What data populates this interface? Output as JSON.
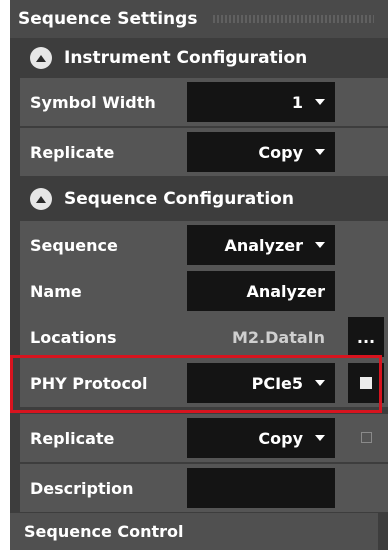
{
  "panel": {
    "title": "Sequence Settings"
  },
  "instrument_config": {
    "header": "Instrument Configuration",
    "rows": {
      "symbol_width": {
        "label": "Symbol Width",
        "value": "1"
      },
      "replicate": {
        "label": "Replicate",
        "value": "Copy"
      }
    }
  },
  "sequence_config": {
    "header": "Sequence Configuration",
    "rows": {
      "sequence": {
        "label": "Sequence",
        "value": "Analyzer"
      },
      "name": {
        "label": "Name",
        "value": "Analyzer"
      },
      "locations": {
        "label": "Locations",
        "value": "M2.DataIn",
        "button": "..."
      },
      "phy_protocol": {
        "label": "PHY Protocol",
        "value": "PCIe5",
        "checked": true
      },
      "replicate": {
        "label": "Replicate",
        "value": "Copy",
        "checked": false
      },
      "description": {
        "label": "Description",
        "value": ""
      }
    }
  },
  "footer": {
    "label": "Sequence Control"
  },
  "colors": {
    "panel_bg": "#3d3d3d",
    "row_bg": "#555555",
    "field_bg": "#141414",
    "highlight": "#d7141f"
  }
}
